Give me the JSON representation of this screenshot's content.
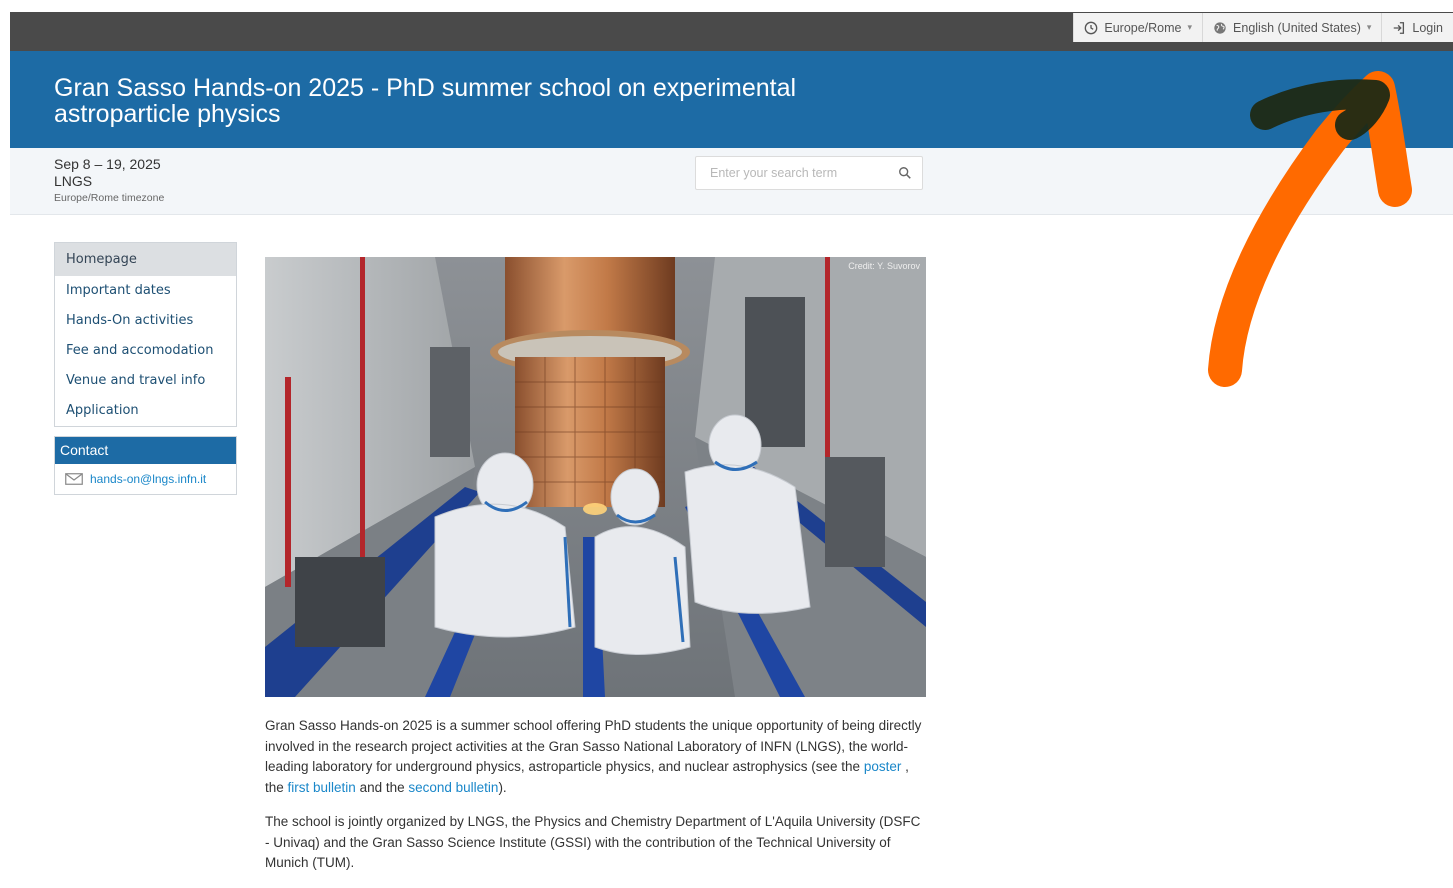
{
  "topbar": {
    "timezone": "Europe/Rome",
    "language": "English (United States)",
    "login": "Login"
  },
  "header": {
    "title": "Gran Sasso Hands-on 2025 - PhD summer school on experimental astroparticle physics"
  },
  "event": {
    "dates": "Sep 8 – 19, 2025",
    "venue": "LNGS",
    "timezone_note": "Europe/Rome timezone"
  },
  "search": {
    "placeholder": "Enter your search term"
  },
  "menu": {
    "items": [
      {
        "label": "Homepage"
      },
      {
        "label": "Important dates"
      },
      {
        "label": "Hands-On activities"
      },
      {
        "label": "Fee and accomodation"
      },
      {
        "label": "Venue and travel info"
      },
      {
        "label": "Application"
      }
    ]
  },
  "contact": {
    "title": "Contact",
    "email": "hands-on@lngs.infn.it"
  },
  "photo": {
    "credit": "Credit: Y. Suvorov"
  },
  "content": {
    "p1_a": "Gran Sasso Hands-on 2025 is a summer school offering PhD students the unique opportunity of being directly involved in the research project activities at the Gran Sasso National Laboratory of INFN (LNGS), the world-leading laboratory for underground physics, astroparticle physics, and nuclear astrophysics (see the ",
    "link_poster": "poster",
    "p1_b": " , the ",
    "link_first": "first bulletin",
    "p1_c": " and the ",
    "link_second": "second bulletin",
    "p1_d": ").",
    "p2": "The school is jointly organized by LNGS, the Physics and Chemistry Department of L'Aquila University (DSFC - Univaq) and the Gran Sasso Science Institute (GSSI) with the contribution of the Technical University of Munich (TUM)."
  },
  "colors": {
    "topbar": "#4a4a4a",
    "header": "#1d6ba5",
    "link": "#1a87c9",
    "annotation_arrow": "#ff6a00",
    "annotation_mark": "#1f2a14"
  },
  "icons": {
    "timezone": "clock-icon",
    "language": "globe-icon",
    "login": "login-icon",
    "search": "search-icon",
    "email": "envelope-icon"
  }
}
